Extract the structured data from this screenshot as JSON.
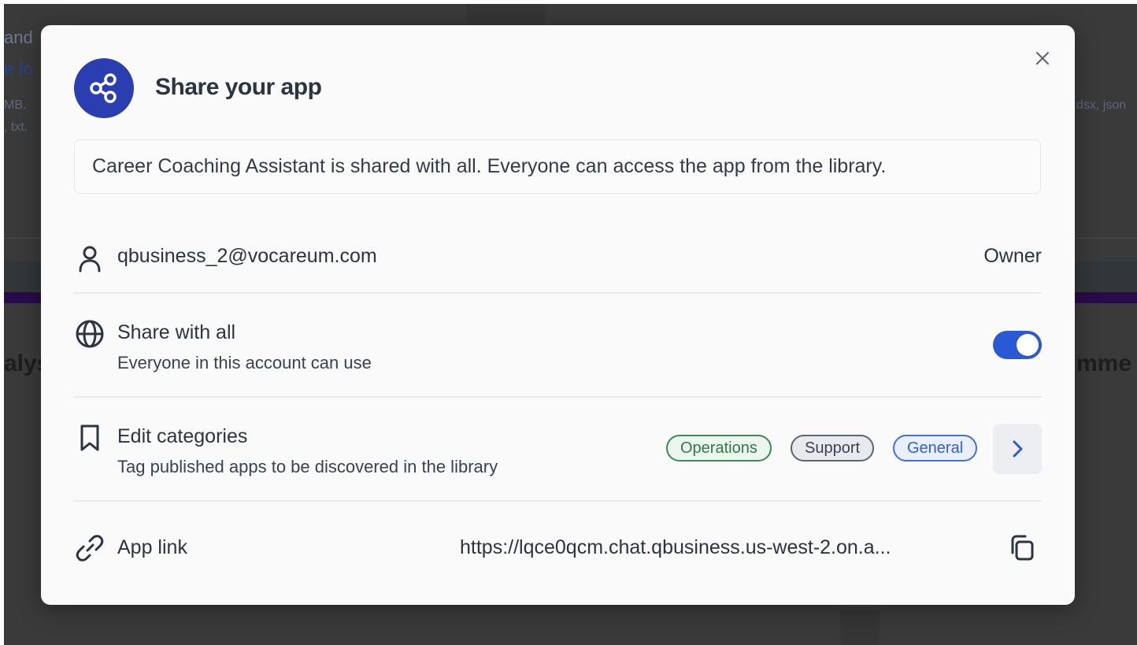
{
  "background": {
    "fragments": [
      "and",
      "e fo",
      "MB.",
      ", txt.",
      "dsx, json",
      "alys",
      "mme"
    ]
  },
  "modal": {
    "title": "Share your app",
    "notice": "Career Coaching Assistant is shared with all. Everyone can access the app from the library.",
    "owner_row": {
      "email": "qbusiness_2@vocareum.com",
      "role": "Owner",
      "icon": "user-icon"
    },
    "share_row": {
      "title": "Share with all",
      "subtitle": "Everyone in this account can use",
      "toggle_on": true,
      "icon": "globe-icon"
    },
    "categories_row": {
      "title": "Edit categories",
      "subtitle": "Tag published apps to be discovered in the library",
      "chips": [
        "Operations",
        "Support",
        "General"
      ],
      "icon": "bookmark-icon"
    },
    "link_row": {
      "title": "App link",
      "url": "https://lqce0qcm.chat.qbusiness.us-west-2.on.a...",
      "icon": "link-icon"
    }
  },
  "colors": {
    "accent": "#2a3eb1",
    "toggle": "#2a59d6"
  }
}
